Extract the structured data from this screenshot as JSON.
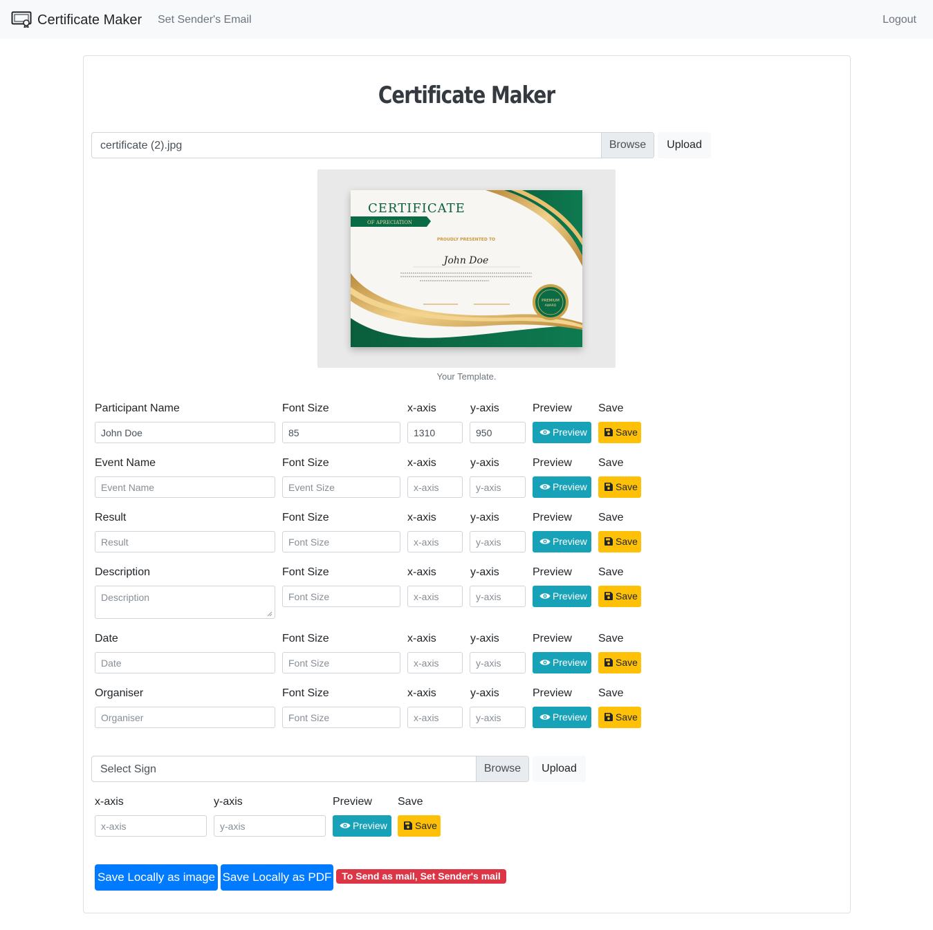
{
  "navbar": {
    "brand": "Certificate Maker",
    "set_email_link": "Set Sender's Email",
    "logout_link": "Logout"
  },
  "page": {
    "title": "Certificate Maker"
  },
  "template_upload": {
    "file_name": "certificate (2).jpg",
    "browse_label": "Browse",
    "upload_label": "Upload",
    "caption": "Your Template."
  },
  "certificate_preview": {
    "heading": "CERTIFICATE",
    "ribbon": "OF APRECIATION",
    "presented": "PROUDLY PRESENTED TO",
    "name": "John Doe",
    "seal_line1": "PREMIUM",
    "seal_line2": "AWARD"
  },
  "columns": {
    "font_size": "Font Size",
    "x_axis": "x-axis",
    "y_axis": "y-axis",
    "preview": "Preview",
    "save": "Save"
  },
  "buttons": {
    "preview": "Preview",
    "save": "Save"
  },
  "fields": [
    {
      "label": "Participant Name",
      "value": "John Doe",
      "placeholder": "Participant Name",
      "font_size_value": "85",
      "font_size_placeholder": "Font Size",
      "x_value": "1310",
      "x_placeholder": "x-axis",
      "y_value": "950",
      "y_placeholder": "y-axis"
    },
    {
      "label": "Event Name",
      "value": "",
      "placeholder": "Event Name",
      "font_size_value": "",
      "font_size_placeholder": "Event Size",
      "x_value": "",
      "x_placeholder": "x-axis",
      "y_value": "",
      "y_placeholder": "y-axis"
    },
    {
      "label": "Result",
      "value": "",
      "placeholder": "Result",
      "font_size_value": "",
      "font_size_placeholder": "Font Size",
      "x_value": "",
      "x_placeholder": "x-axis",
      "y_value": "",
      "y_placeholder": "y-axis"
    },
    {
      "label": "Description",
      "value": "",
      "placeholder": "Description",
      "font_size_value": "",
      "font_size_placeholder": "Font Size",
      "x_value": "",
      "x_placeholder": "x-axis",
      "y_value": "",
      "y_placeholder": "y-axis"
    },
    {
      "label": "Date",
      "value": "",
      "placeholder": "Date",
      "font_size_value": "",
      "font_size_placeholder": "Font Size",
      "x_value": "",
      "x_placeholder": "x-axis",
      "y_value": "",
      "y_placeholder": "y-axis"
    },
    {
      "label": "Organiser",
      "value": "",
      "placeholder": "Organiser",
      "font_size_value": "",
      "font_size_placeholder": "Font Size",
      "x_value": "",
      "x_placeholder": "x-axis",
      "y_value": "",
      "y_placeholder": "y-axis"
    }
  ],
  "sign_upload": {
    "file_text": "Select Sign",
    "browse_label": "Browse",
    "upload_label": "Upload",
    "x_label": "x-axis",
    "y_label": "y-axis",
    "x_placeholder": "x-axis",
    "y_placeholder": "y-axis",
    "preview_label": "Preview",
    "save_label": "Save"
  },
  "actions": {
    "save_image": "Save Locally as image",
    "save_pdf": "Save Locally as PDF",
    "mail_warning": "To Send as mail, Set Sender's mail"
  },
  "colors": {
    "primary": "#007bff",
    "info": "#17a2b8",
    "warning": "#ffc107",
    "danger": "#dc3545",
    "cert_green": "#0b6b45",
    "cert_gold": "#d4a64a"
  },
  "icons": {
    "brand": "certificate-icon",
    "preview": "eye-icon",
    "save": "floppy-disk-icon"
  }
}
